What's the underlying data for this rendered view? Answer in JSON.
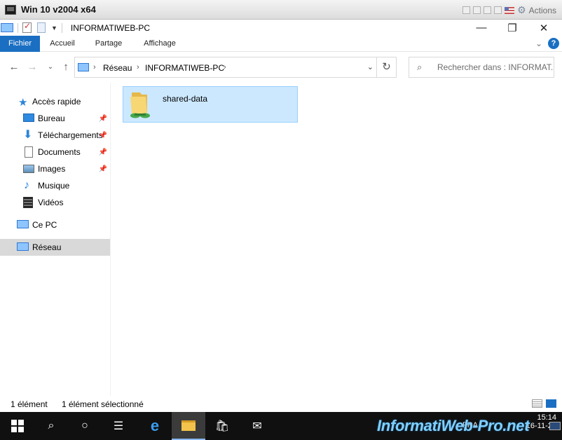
{
  "vm": {
    "title": "Win 10 v2004 x64",
    "actions_label": "Actions"
  },
  "window": {
    "title": "INFORMATIWEB-PC",
    "minimize": "—",
    "maximize": "❐",
    "close": "✕"
  },
  "ribbon": {
    "tabs": [
      "Fichier",
      "Accueil",
      "Partage",
      "Affichage"
    ],
    "help": "?"
  },
  "address": {
    "crumbs": [
      "Réseau",
      "INFORMATIWEB-PC"
    ]
  },
  "search": {
    "placeholder": "Rechercher dans : INFORMAT..."
  },
  "sidebar": {
    "quick_access": "Accès rapide",
    "items": [
      {
        "label": "Bureau",
        "icon": "desktop-icon",
        "pinned": true
      },
      {
        "label": "Téléchargements",
        "icon": "download-icon",
        "pinned": true
      },
      {
        "label": "Documents",
        "icon": "documents-icon",
        "pinned": true
      },
      {
        "label": "Images",
        "icon": "images-icon",
        "pinned": true
      },
      {
        "label": "Musique",
        "icon": "music-icon",
        "pinned": false
      },
      {
        "label": "Vidéos",
        "icon": "videos-icon",
        "pinned": false
      }
    ],
    "this_pc": "Ce PC",
    "network": "Réseau"
  },
  "content": {
    "items": [
      {
        "name": "shared-data",
        "icon": "shared-folder-icon",
        "selected": true
      }
    ]
  },
  "status": {
    "count": "1 élément",
    "selection": "1 élément sélectionné"
  },
  "taskbar": {
    "lang": "FRA",
    "time": "15:14",
    "date": "16-11-21"
  },
  "watermark": "InformatiWeb-Pro.net"
}
